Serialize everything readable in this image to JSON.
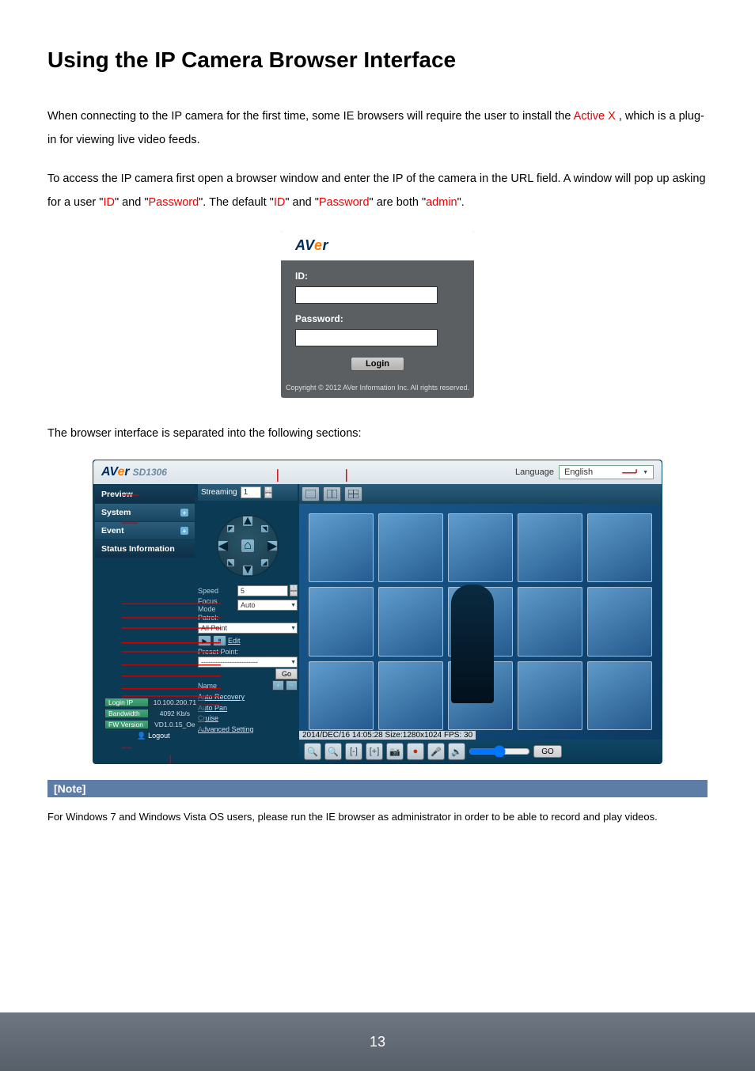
{
  "heading": "Using the IP Camera Browser Interface",
  "p1_a": "When connecting to the IP camera for the first time, some IE browsers will require the user to install the ",
  "p1_b": "Active X",
  "p1_c": ", which is a plug-in for viewing live video feeds.",
  "p2_a": "To access the IP camera first open a browser window and enter the IP of the camera in the URL field. A window will pop up asking for a user \"",
  "p2_id": "ID",
  "p2_b": "\" and \"",
  "p2_pw": "Password",
  "p2_c": "\". The default \"",
  "p2_d": "\" and \"",
  "p2_e": "\" are both \"",
  "p2_admin": "admin",
  "p2_f": "\".",
  "login": {
    "id_label": "ID:",
    "pw_label": "Password:",
    "btn": "Login",
    "copy": "Copyright © 2012 AVer Information Inc. All rights reserved."
  },
  "p3": "The browser interface is separated into the following sections:",
  "browser": {
    "model": "SD1306",
    "lang_label": "Language",
    "lang_value": "English",
    "sidebar": {
      "preview": "Preview",
      "system": "System",
      "event": "Event",
      "status": "Status Information"
    },
    "stream_label": "Streaming",
    "stream_value": "1",
    "speed_label": "Speed",
    "speed_value": "5",
    "focus_label": "Focus Mode",
    "focus_value": "Auto",
    "patrol_label": "Patrol:",
    "patrol_value": "All Point",
    "edit": "Edit",
    "preset_label": "Preset Point:",
    "preset_value": "------------------------",
    "go": "Go",
    "name_label": "Name",
    "adv": {
      "auto_recovery": "Auto Recovery",
      "auto_pan": "Auto Pan",
      "cruise": "Cruise",
      "advanced": "Advanced Setting"
    },
    "info": {
      "login_ip_lab": "Login IP",
      "login_ip_val": "10.100.200.71",
      "bandwidth_lab": "Bandwidth",
      "bandwidth_val": "4092 Kb/s",
      "fw_lab": "FW Version",
      "fw_val": "VD1.0.15_Oe"
    },
    "logout": "Logout",
    "stamp": "2014/DEC/16 14:05:28 Size:1280x1024 FPS: 30",
    "toolbar": {
      "go": "GO"
    }
  },
  "note_title": "[Note]",
  "note_text": "For Windows 7 and Windows Vista OS users, please run the IE browser as administrator in order to be able to record and play videos.",
  "page_number": "13"
}
